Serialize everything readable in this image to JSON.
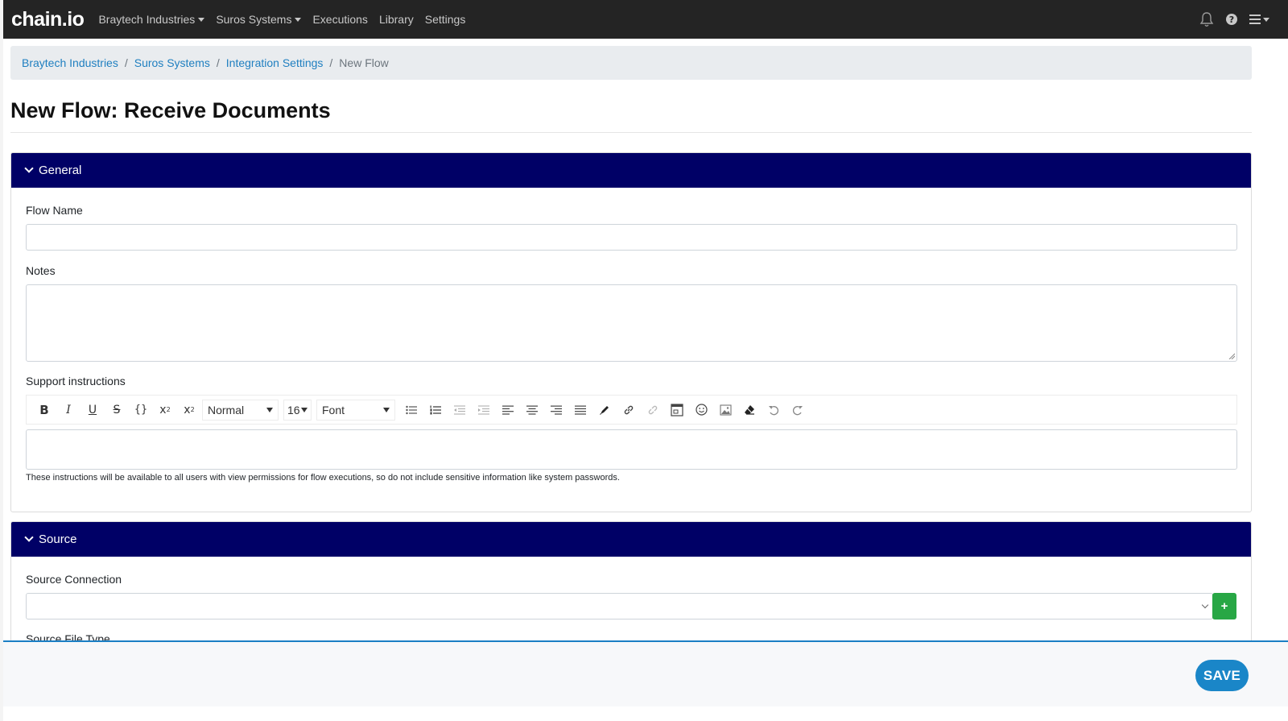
{
  "app": {
    "logo_text": "chain.io"
  },
  "nav": {
    "items": [
      {
        "label": "Braytech Industries",
        "dropdown": true
      },
      {
        "label": "Suros Systems",
        "dropdown": true
      },
      {
        "label": "Executions",
        "dropdown": false
      },
      {
        "label": "Library",
        "dropdown": false
      },
      {
        "label": "Settings",
        "dropdown": false
      }
    ],
    "icons": [
      "bell-icon",
      "help-icon",
      "menu-icon"
    ]
  },
  "breadcrumb": {
    "items": [
      "Braytech Industries",
      "Suros Systems",
      "Integration Settings"
    ],
    "current": "New Flow"
  },
  "page": {
    "title": "New Flow: Receive Documents"
  },
  "general": {
    "header": "General",
    "flow_name_label": "Flow Name",
    "flow_name_value": "",
    "notes_label": "Notes",
    "notes_value": "",
    "support_label": "Support instructions",
    "toolbar": {
      "heading_select": "Normal",
      "size_select": "16",
      "font_select": "Font"
    },
    "support_value": "",
    "help_text": "These instructions will be available to all users with view permissions for flow executions, so do not include sensitive information like system passwords."
  },
  "source": {
    "header": "Source",
    "connection_label": "Source Connection",
    "connection_value": "",
    "add_label": "+",
    "file_type_label": "Source File Type"
  },
  "footer": {
    "save_label": "SAVE"
  },
  "colors": {
    "navbar": "#242424",
    "panel_header": "#000066",
    "link": "#1f7fc0",
    "save": "#1a86c8",
    "add": "#28a745"
  }
}
